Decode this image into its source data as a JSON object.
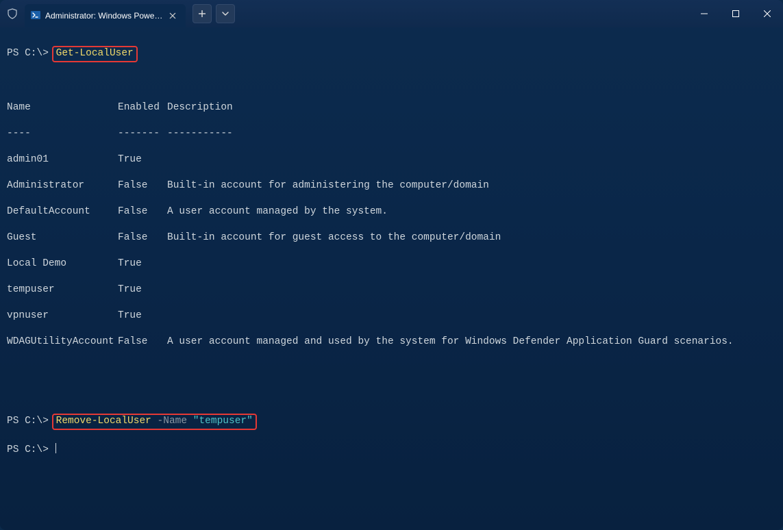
{
  "window": {
    "tab_title": "Administrator: Windows Powe…",
    "active": true
  },
  "prompt": "PS C:\\>",
  "commands": {
    "cmd1": "Get-LocalUser",
    "cmd2_cmdlet": "Remove-LocalUser",
    "cmd2_param": " -Name ",
    "cmd2_value": "\"tempuser\""
  },
  "table": {
    "header": {
      "name": "Name",
      "enabled": "Enabled",
      "description": "Description"
    },
    "divider": {
      "name": "----",
      "enabled": "-------",
      "description": "-----------"
    },
    "rows": [
      {
        "name": "admin01",
        "enabled": "True",
        "description": ""
      },
      {
        "name": "Administrator",
        "enabled": "False",
        "description": "Built-in account for administering the computer/domain"
      },
      {
        "name": "DefaultAccount",
        "enabled": "False",
        "description": "A user account managed by the system."
      },
      {
        "name": "Guest",
        "enabled": "False",
        "description": "Built-in account for guest access to the computer/domain"
      },
      {
        "name": "Local Demo",
        "enabled": "True",
        "description": ""
      },
      {
        "name": "tempuser",
        "enabled": "True",
        "description": ""
      },
      {
        "name": "vpnuser",
        "enabled": "True",
        "description": ""
      },
      {
        "name": "WDAGUtilityAccount",
        "enabled": "False",
        "description": "A user account managed and used by the system for Windows Defender Application Guard scenarios."
      }
    ]
  }
}
